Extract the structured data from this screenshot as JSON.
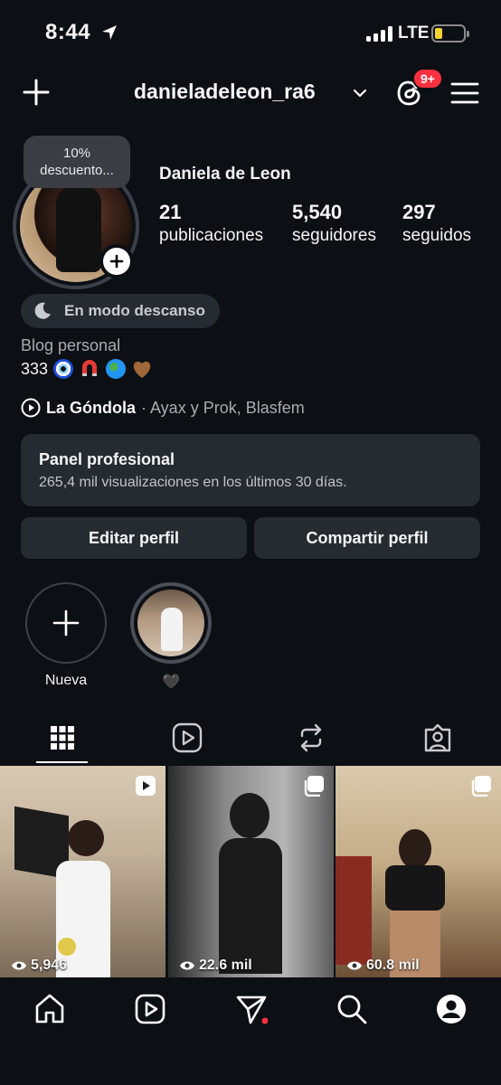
{
  "status_bar": {
    "time": "8:44",
    "network": "LTE"
  },
  "header": {
    "username": "danieladeleon_ra6",
    "notification_badge": "9+"
  },
  "profile": {
    "note_line1": "10%",
    "note_line2": "descuento...",
    "name": "Daniela de Leon",
    "stats": [
      {
        "value": "21",
        "label": "publicaciones"
      },
      {
        "value": "5,540",
        "label": "seguidores"
      },
      {
        "value": "297",
        "label": "seguidos"
      }
    ],
    "rest_mode": "En modo descanso",
    "category": "Blog personal",
    "bio_text": "333",
    "bio_emojis": [
      "nazar-amulet",
      "magnet",
      "globe",
      "brown-heart"
    ],
    "music_song": "La Góndola",
    "music_artists": "· Ayax y Prok, Blasfem"
  },
  "pro_panel": {
    "title": "Panel profesional",
    "subtitle": "265,4 mil visualizaciones en los últimos 30 días."
  },
  "buttons": {
    "edit": "Editar perfil",
    "share": "Compartir perfil"
  },
  "highlights": [
    {
      "label": "Nueva"
    },
    {
      "label": "🖤"
    }
  ],
  "posts": [
    {
      "views": "5,946",
      "type": "reel"
    },
    {
      "views": "22.6 mil",
      "type": "carousel"
    },
    {
      "views": "60.8 mil",
      "type": "carousel"
    }
  ],
  "colors": {
    "background": "#0c0f14",
    "surface": "#262a31",
    "badge": "#ff3040",
    "battery": "#f4d22f"
  }
}
